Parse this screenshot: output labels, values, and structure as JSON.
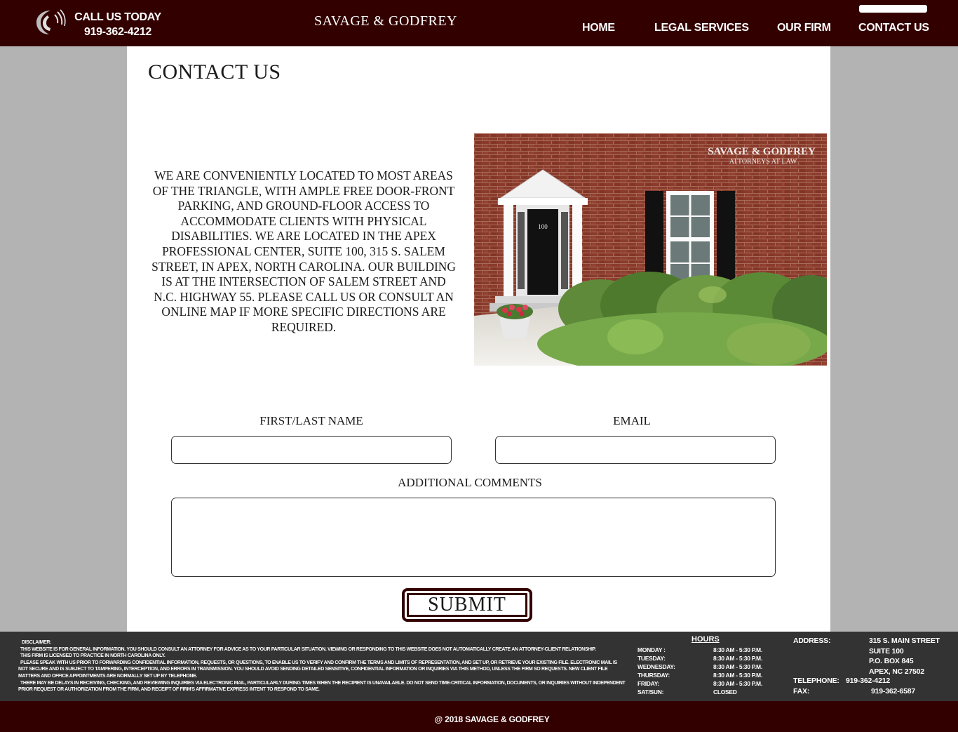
{
  "header": {
    "call_label": "CALL US TODAY",
    "phone": "919-362-4212",
    "brand": "SAVAGE & GODFREY",
    "nav": [
      "HOME",
      "LEGAL SERVICES",
      "OUR FIRM",
      "CONTACT US"
    ]
  },
  "main": {
    "title": "CONTACT US",
    "about": "WE ARE CONVENIENTLY LOCATED TO MOST AREAS OF THE TRIANGLE, WITH AMPLE FREE DOOR-FRONT PARKING, AND GROUND-FLOOR ACCESS TO ACCOMMODATE CLIENTS WITH PHYSICAL DISABILITIES. WE ARE LOCATED IN THE APEX PROFESSIONAL CENTER, SUITE 100, 315 S. SALEM STREET, IN APEX, NORTH CAROLINA. OUR BUILDING IS AT THE INTERSECTION OF SALEM STREET AND N.C. HIGHWAY 55. PLEASE CALL US OR CONSULT AN ONLINE MAP IF MORE SPECIFIC DIRECTIONS ARE REQUIRED.",
    "sign_line1": "SAVAGE & GODFREY",
    "sign_line2": "ATTORNEYS AT LAW",
    "door_number": "100"
  },
  "form": {
    "name_label": "FIRST/LAST NAME",
    "name_value": "",
    "email_label": "EMAIL",
    "email_value": "",
    "comments_label": "ADDITIONAL COMMENTS",
    "comments_value": "",
    "submit_label": "SUBMIT"
  },
  "disclaimer": {
    "title": "DISCLAIMER:",
    "p1": "THIS WEBSITE IS FOR GENERAL INFORMATION. YOU SHOULD CONSULT AN ATTORNEY FOR ADVICE AS TO YOUR PARTICULAR SITUATION. VIEWING OR RESPONDING TO THIS WEBSITE DOES NOT AUTOMATICALLY CREATE AN ATTORNEY-CLIENT RELATIONSHIP.",
    "p2": "THIS FIRM IS LICENSED TO PRACTICE IN NORTH CAROLINA ONLY.",
    "p3": "PLEASE SPEAK WITH US PRIOR TO FORWARDING CONFIDENTIAL INFORMATION, REQUESTS, OR QUESTIONS, TO ENABLE US TO VERIFY AND CONFIRM THE TERMS AND LIMITS OF REPRESENTATION, AND SET UP, OR RETRIEVE YOUR EXISTING FILE. ELECTRONIC MAIL IS NOT SECURE AND IS SUBJECT TO TAMPERING, INTERCEPTION, AND ERRORS IN TRANSMISSION. YOU SHOULD AVOID SENDING DETAILED SENSITIVE, CONFIDENTIAL INFORMATION OR INQUIRIES VIA THIS METHOD, UNLESS THE FIRM SO REQUESTS. NEW CLIENT FILE MATTERS AND OFFICE APPOINTMENTS ARE NORMALLY SET UP BY TELEPHONE.",
    "p4": "THERE MAY BE DELAYS IN RECEIVING, CHECKING, AND REVIEWING INQUIRIES VIA ELECTRONIC MAIL, PARTICULARLY DURING TIMES WHEN THE RECIPIENT IS UNAVAILABLE. DO NOT SEND TIME-CRITICAL INFORMATION, DOCUMENTS, OR INQUIRIES WITHOUT INDEPENDENT PRIOR REQUEST OR AUTHORIZATION FROM THE FIRM, AND RECEIPT OF FIRM'S AFFIRMATIVE EXPRESS INTENT TO RESPOND TO SAME."
  },
  "hours": {
    "title": "HOURS",
    "rows": [
      {
        "day": "MONDAY :",
        "time": "8:30 AM - 5:30 P.M."
      },
      {
        "day": "TUESDAY:",
        "time": "8:30 AM - 5:30 P.M."
      },
      {
        "day": "WEDNESDAY:",
        "time": "8:30 AM - 5:30 P.M."
      },
      {
        "day": "THURSDAY:",
        "time": "8:30 AM - 5:30 P.M."
      },
      {
        "day": "FRIDAY:",
        "time": "8:30 AM - 5:30 P.M."
      },
      {
        "day": "SAT/SUN:",
        "time": "CLOSED"
      }
    ]
  },
  "contact": {
    "address_label": "ADDRESS:",
    "address_lines": [
      "315 S. MAIN STREET",
      "SUITE 100",
      "P.O. BOX 845",
      "APEX, NC 27502"
    ],
    "telephone_label": "TELEPHONE:",
    "telephone": "919-362-4212",
    "fax_label": "FAX:",
    "fax": "919-362-6587"
  },
  "footer": {
    "copyright": "@ 2018 SAVAGE & GODFREY"
  },
  "colors": {
    "brand_dark": "#330000",
    "page_bg": "#b3b3b3",
    "info_bar": "#333333"
  },
  "icons": {
    "logo": "phone-swoosh-logo-icon"
  }
}
